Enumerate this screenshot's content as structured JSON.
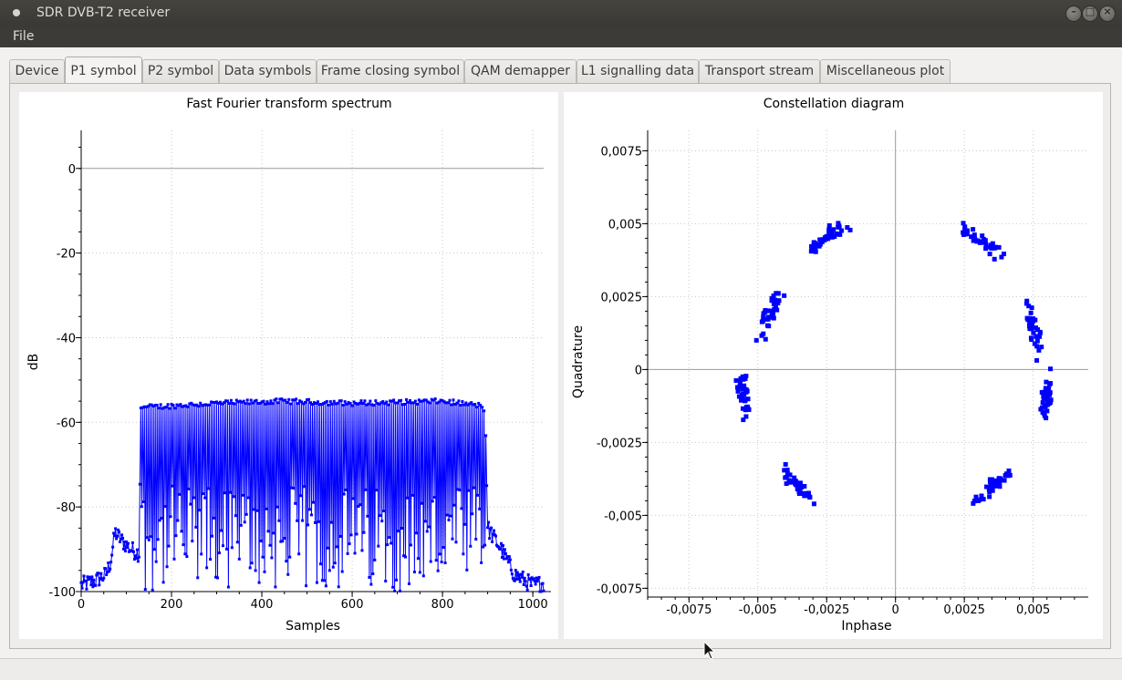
{
  "window": {
    "title": "SDR DVB-T2 receiver"
  },
  "menu": {
    "file": "File"
  },
  "tabs": [
    {
      "label": "Device"
    },
    {
      "label": "P1 symbol"
    },
    {
      "label": "P2 symbol"
    },
    {
      "label": "Data symbols"
    },
    {
      "label": "Frame closing symbol"
    },
    {
      "label": "QAM demapper"
    },
    {
      "label": "L1 signalling data"
    },
    {
      "label": "Transport stream"
    },
    {
      "label": "Miscellaneous plot"
    }
  ],
  "active_tab": "P1 symbol",
  "chart_data": [
    {
      "type": "line",
      "title": "Fast Fourier transform spectrum",
      "xlabel": "Samples",
      "ylabel": "dB",
      "xlim": [
        0,
        1024
      ],
      "ylim": [
        -100,
        9
      ],
      "xticks": [
        "0",
        "200",
        "400",
        "600",
        "800",
        "1000"
      ],
      "yticks": [
        "0",
        "-20",
        "-40",
        "-60",
        "-80",
        "-100"
      ],
      "grid": true,
      "color": "#0000ff",
      "series": [
        {
          "description_points": [
            {
              "x": 0,
              "y": -98.5
            },
            {
              "x": 30,
              "y": -97.5
            },
            {
              "x": 55,
              "y": -96
            },
            {
              "x": 65,
              "y": -93
            },
            {
              "x": 75,
              "y": -86
            },
            {
              "x": 90,
              "y": -88
            },
            {
              "x": 110,
              "y": -90
            },
            {
              "x": 128,
              "y": -91
            },
            {
              "x": 132,
              "y": -56.5
            },
            {
              "x": 300,
              "y": -55.5
            },
            {
              "x": 450,
              "y": -55
            },
            {
              "x": 600,
              "y": -55.5
            },
            {
              "x": 800,
              "y": -55
            },
            {
              "x": 880,
              "y": -56
            },
            {
              "x": 895,
              "y": -57
            },
            {
              "x": 900,
              "y": -85
            },
            {
              "x": 930,
              "y": -90
            },
            {
              "x": 960,
              "y": -96
            },
            {
              "x": 1000,
              "y": -98.5
            },
            {
              "x": 1024,
              "y": -98
            }
          ],
          "band_carriers_floor_min": -100,
          "band_carriers_floor_max": -75
        }
      ]
    },
    {
      "type": "scatter",
      "title": "Constellation diagram",
      "xlabel": "Inphase",
      "ylabel": "Quadrature",
      "xlim": [
        -0.009,
        0.007
      ],
      "ylim": [
        -0.0078,
        0.0082
      ],
      "xticks": [
        "-0,0075",
        "-0,005",
        "-0,0025",
        "0",
        "0,0025",
        "0,005"
      ],
      "yticks": [
        "0,0075",
        "0,005",
        "0,0025",
        "0",
        "-0,0025",
        "-0,005",
        "-0,0075"
      ],
      "grid": true,
      "color": "#0000ff",
      "clusters": [
        {
          "center_x": -0.0025,
          "center_y": 0.0045,
          "spread": 0.0006
        },
        {
          "center_x": 0.003,
          "center_y": 0.0045,
          "spread": 0.0006
        },
        {
          "center_x": -0.0045,
          "center_y": 0.002,
          "spread": 0.0006
        },
        {
          "center_x": 0.005,
          "center_y": 0.0015,
          "spread": 0.0006
        },
        {
          "center_x": -0.0055,
          "center_y": -0.001,
          "spread": 0.0006
        },
        {
          "center_x": 0.0055,
          "center_y": -0.001,
          "spread": 0.0006
        },
        {
          "center_x": -0.0035,
          "center_y": -0.004,
          "spread": 0.0006
        },
        {
          "center_x": 0.0035,
          "center_y": -0.004,
          "spread": 0.0006
        }
      ],
      "points_per_cluster": 40
    }
  ]
}
